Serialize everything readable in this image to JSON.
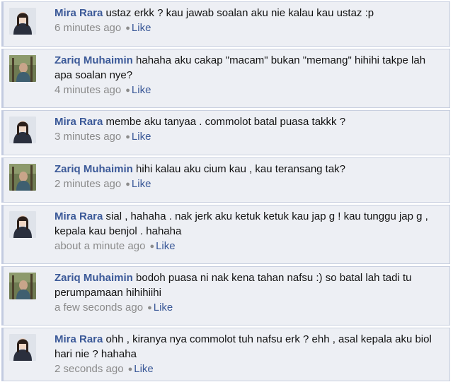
{
  "comments": [
    {
      "author": "Mira Rara",
      "text": "ustaz erkk ? kau jawab soalan aku nie kalau kau ustaz :p",
      "time": "6 minutes ago",
      "like": "Like"
    },
    {
      "author": "Zariq Muhaimin",
      "text": "hahaha aku cakap \"macam\" bukan \"memang\" hihihi takpe lah apa soalan nye?",
      "time": "4 minutes ago",
      "like": "Like"
    },
    {
      "author": "Mira Rara",
      "text": "membe aku tanyaa . commolot batal puasa takkk ?",
      "time": "3 minutes ago",
      "like": "Like"
    },
    {
      "author": "Zariq Muhaimin",
      "text": "hihi kalau aku cium kau , kau teransang tak?",
      "time": "2 minutes ago",
      "like": "Like"
    },
    {
      "author": "Mira Rara",
      "text": "sial , hahaha . nak jerk aku ketuk ketuk kau jap g ! kau tunggu jap g , kepala kau benjol . hahaha",
      "time": "about a minute ago",
      "like": "Like"
    },
    {
      "author": "Zariq Muhaimin",
      "text": "bodoh puasa ni nak kena tahan nafsu :) so batal lah tadi tu perumpamaan hihihiihi",
      "time": "a few seconds ago",
      "like": "Like"
    },
    {
      "author": "Mira Rara",
      "text": "ohh , kiranya nya commolot tuh nafsu erk ? ehh , asal kepala aku biol hari nie ? hahaha",
      "time": "2 seconds ago",
      "like": "Like"
    }
  ]
}
